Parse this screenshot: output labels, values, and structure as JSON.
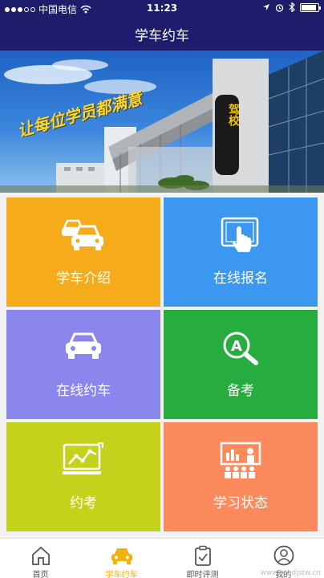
{
  "status_bar": {
    "carrier": "中国电信",
    "time": "11:23"
  },
  "nav": {
    "title": "学车约车"
  },
  "banner": {
    "slogan": "让每位学员都满意",
    "sign_text": "驾校"
  },
  "tiles": [
    {
      "label": "学车介绍",
      "color": "#f6ac1a",
      "icon": "cars-icon"
    },
    {
      "label": "在线报名",
      "color": "#3c97f1",
      "icon": "tablet-touch-icon"
    },
    {
      "label": "在线约车",
      "color": "#8a86ee",
      "icon": "car-icon"
    },
    {
      "label": "备考",
      "color": "#27ad3f",
      "icon": "search-a-icon"
    },
    {
      "label": "约考",
      "color": "#c4d21b",
      "icon": "chart-board-icon"
    },
    {
      "label": "学习状态",
      "color": "#fc8a5d",
      "icon": "presentation-icon"
    }
  ],
  "tabbar": {
    "items": [
      {
        "label": "首页",
        "icon": "home-icon",
        "active": false
      },
      {
        "label": "学车约车",
        "icon": "car-icon",
        "active": true
      },
      {
        "label": "即时评测",
        "icon": "clipboard-check-icon",
        "active": false
      },
      {
        "label": "我的",
        "icon": "user-icon",
        "active": false
      }
    ],
    "active_color": "#f3b20a"
  },
  "watermark": "www.rnadjstw.cn"
}
